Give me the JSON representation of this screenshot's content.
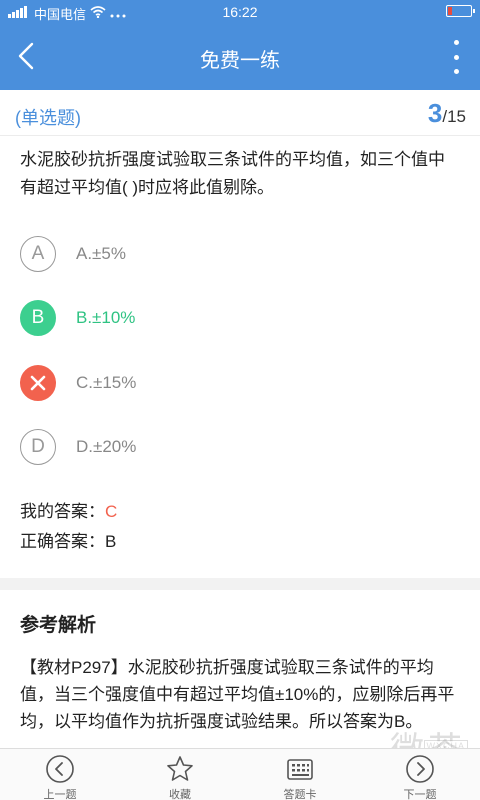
{
  "status_bar": {
    "carrier": "中国电信",
    "time": "16:22",
    "battery_level": 0.2
  },
  "header": {
    "title": "免费一练"
  },
  "question": {
    "type": "(单选题)",
    "current": "3",
    "total": "/15",
    "text": "水泥胶砂抗折强度试验取三条试件的平均值，如三个值中有超过平均值( )时应将此值剔除。"
  },
  "options": [
    {
      "letter": "A",
      "text": "A.±5%",
      "state": "normal"
    },
    {
      "letter": "B",
      "text": "B.±10%",
      "state": "correct"
    },
    {
      "letter": "C",
      "text": "C.±15%",
      "state": "wrong"
    },
    {
      "letter": "D",
      "text": "D.±20%",
      "state": "normal"
    }
  ],
  "answers": {
    "my_label": "我的答案：",
    "my_value": "C",
    "correct_label": "正确答案：",
    "correct_value": "B"
  },
  "analysis": {
    "title": "参考解析",
    "text": "【教材P297】水泥胶砂抗折强度试验取三条试件的平均值，当三个强度值中有超过平均值±10%的，应剔除后再平均，以平均值作为抗折强度试验结果。所以答案为B。"
  },
  "bottom_bar": {
    "prev": "上一题",
    "favorite": "收藏",
    "answer_card": "答题卡",
    "next": "下一题"
  },
  "watermark": {
    "text": "微茶",
    "sub": "WXCHA"
  },
  "colors": {
    "primary": "#4a8fdc",
    "correct": "#3ccf8f",
    "wrong": "#f2624e"
  }
}
